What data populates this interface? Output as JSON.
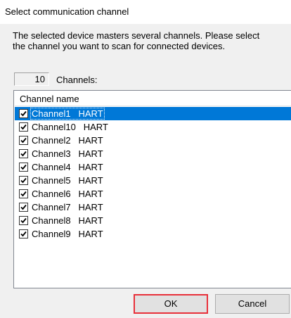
{
  "dialog": {
    "title": "Select communication channel",
    "description": "The selected device masters several channels.  Please select\nthe channel you want to scan for connected devices.",
    "channel_count": "10",
    "channel_count_label": "Channels:"
  },
  "list": {
    "header": "Channel name",
    "items": [
      {
        "label": "Channel1   HART",
        "checked": true,
        "selected": true
      },
      {
        "label": "Channel10   HART",
        "checked": true,
        "selected": false
      },
      {
        "label": "Channel2   HART",
        "checked": true,
        "selected": false
      },
      {
        "label": "Channel3   HART",
        "checked": true,
        "selected": false
      },
      {
        "label": "Channel4   HART",
        "checked": true,
        "selected": false
      },
      {
        "label": "Channel5   HART",
        "checked": true,
        "selected": false
      },
      {
        "label": "Channel6   HART",
        "checked": true,
        "selected": false
      },
      {
        "label": "Channel7   HART",
        "checked": true,
        "selected": false
      },
      {
        "label": "Channel8   HART",
        "checked": true,
        "selected": false
      },
      {
        "label": "Channel9   HART",
        "checked": true,
        "selected": false
      }
    ]
  },
  "buttons": {
    "ok": "OK",
    "cancel": "Cancel"
  },
  "colors": {
    "selection": "#0078d7",
    "highlight_border": "#e8303a"
  }
}
